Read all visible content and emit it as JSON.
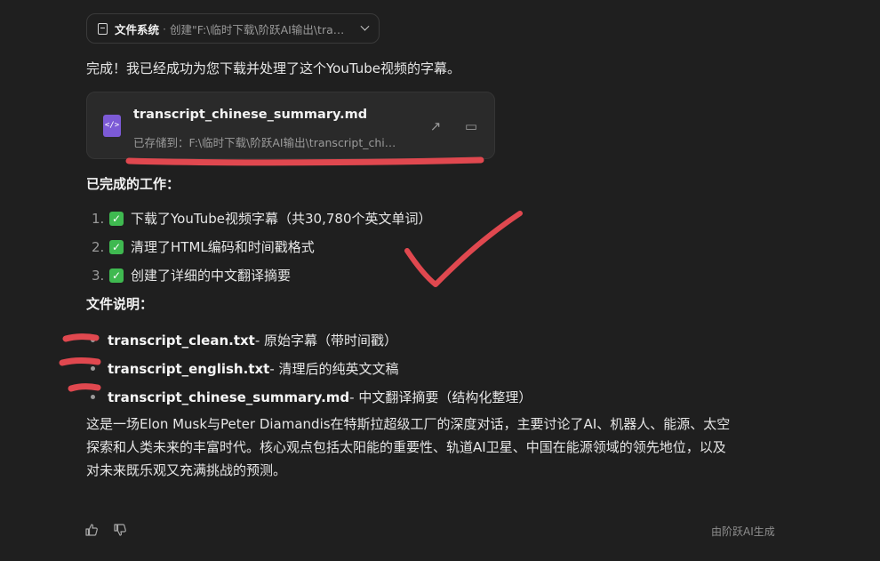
{
  "tool_call": {
    "name": "文件系统",
    "separator": "·",
    "description": "创建\"F:\\临时下载\\阶跃AI输出\\tra…"
  },
  "intro": "完成！我已经成功为您下载并处理了这个YouTube视频的字幕。",
  "file_card": {
    "icon_glyph": "</>",
    "icon_color": "#7c5ad6",
    "filename": "transcript_chinese_summary.md",
    "saved_path": "已存储到：F:\\临时下载\\阶跃AI输出\\transcript_chi…",
    "open_icon": "↗",
    "folder_icon": "▭"
  },
  "completed": {
    "heading": "已完成的工作：",
    "items": [
      {
        "num": "1.",
        "text": "下载了YouTube视频字幕（共30,780个英文单词）"
      },
      {
        "num": "2.",
        "text": "清理了HTML编码和时间戳格式"
      },
      {
        "num": "3.",
        "text": "创建了详细的中文翻译摘要"
      }
    ]
  },
  "files": {
    "heading": "文件说明：",
    "items": [
      {
        "name": "transcript_clean.txt",
        "desc": " - 原始字幕（带时间戳）"
      },
      {
        "name": "transcript_english.txt",
        "desc": " - 清理后的纯英文文稿"
      },
      {
        "name": "transcript_chinese_summary.md",
        "desc": " - 中文翻译摘要（结构化整理）"
      }
    ]
  },
  "summary_lines": [
    "这是一场Elon Musk与Peter Diamandis在特斯拉超级工厂的深度对话，主要讨论了AI、机器人、能源、太空",
    "探索和人类未来的丰富时代。核心观点包括太阳能的重要性、轨道AI卫星、中国在能源领域的领先地位，以及",
    "对未来既乐观又充满挑战的预测。"
  ],
  "footer": {
    "like_icon": "👍",
    "dislike_icon": "👎",
    "note": "由阶跃AI生成"
  },
  "annotation_color": "#e0484f"
}
